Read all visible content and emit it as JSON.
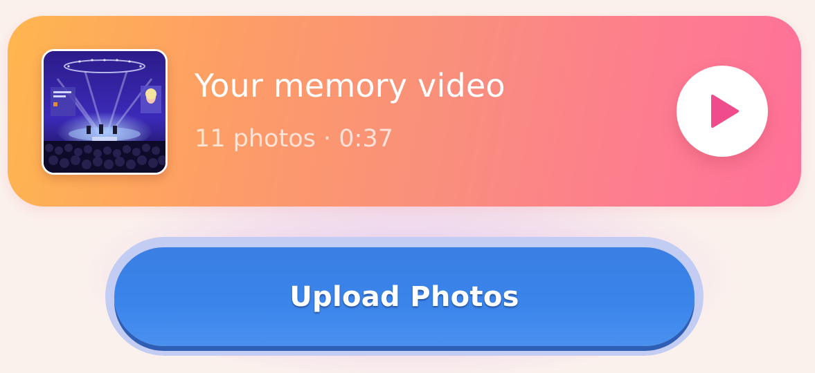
{
  "memory_card": {
    "title": "Your memory video",
    "photo_count": "11 photos",
    "separator": "·",
    "duration": "0:37",
    "play_icon": "play-icon",
    "thumbnail": "concert-stage-thumbnail"
  },
  "upload": {
    "label": "Upload Photos"
  },
  "colors": {
    "card_gradient_start": "#ffb64f",
    "card_gradient_end": "#ff709a",
    "play_accent": "#ef4c8b",
    "upload_button": "#3a84ea",
    "background": "#fbf1ec"
  }
}
